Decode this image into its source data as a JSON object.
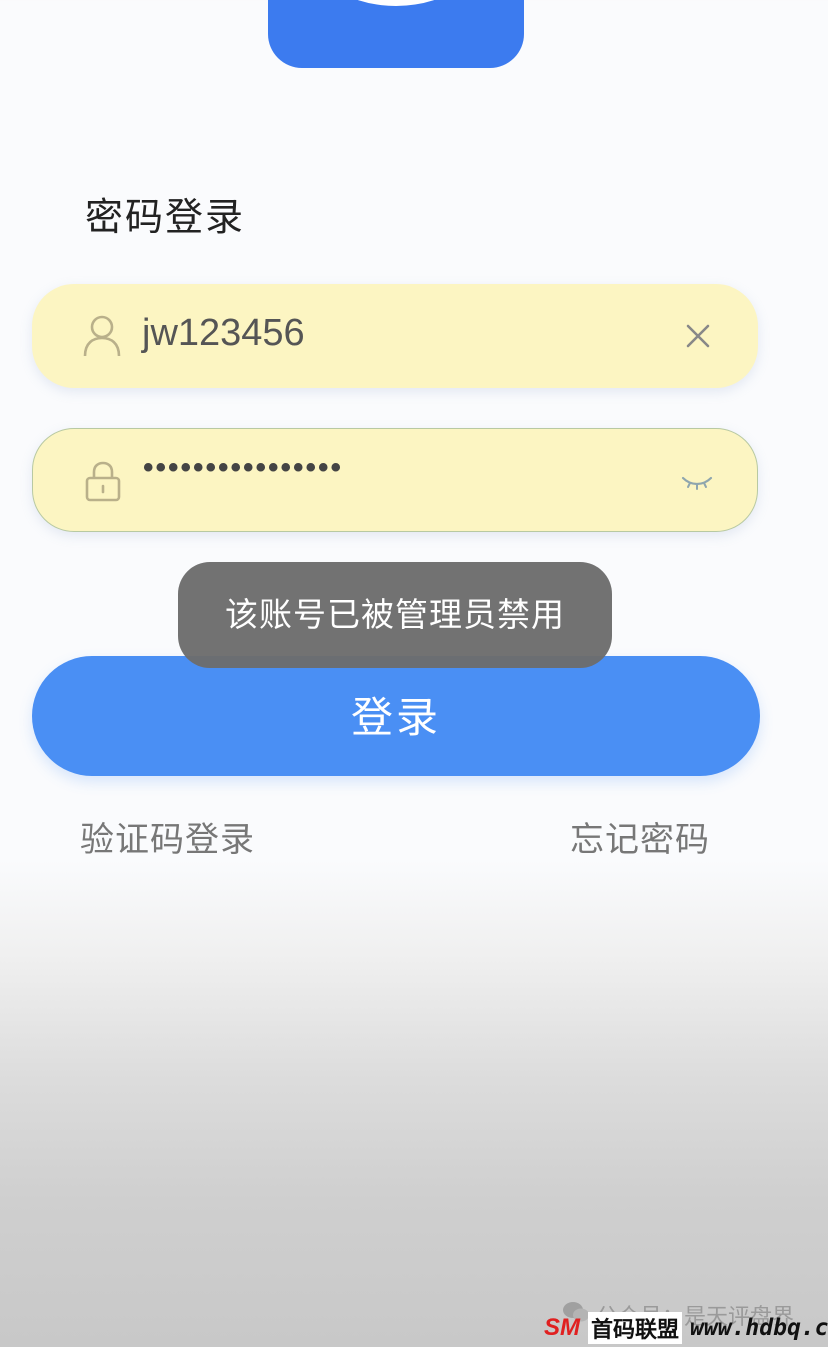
{
  "header": {
    "logo_icon": "app-logo-icon",
    "title": "密码登录"
  },
  "form": {
    "username": {
      "icon": "user-icon",
      "value": "jw123456",
      "clear_icon": "close-icon"
    },
    "password": {
      "icon": "lock-icon",
      "value": "••••••••••••••••",
      "toggle_icon": "eye-closed-icon"
    },
    "submit_label": "登录"
  },
  "toast": {
    "message": "该账号已被管理员禁用"
  },
  "links": {
    "sms_login": "验证码登录",
    "forgot_password": "忘记密码"
  },
  "watermark": {
    "account_text": "公众号：是天评盘界",
    "brand_logo": "SM",
    "brand_name": "首码联盟",
    "url": "www.hdbq.cc"
  },
  "colors": {
    "primary": "#4a8ff4",
    "field_autofill": "#fcf5c2",
    "toast_bg": "#6c6c6c",
    "brand_red": "#e02020"
  }
}
